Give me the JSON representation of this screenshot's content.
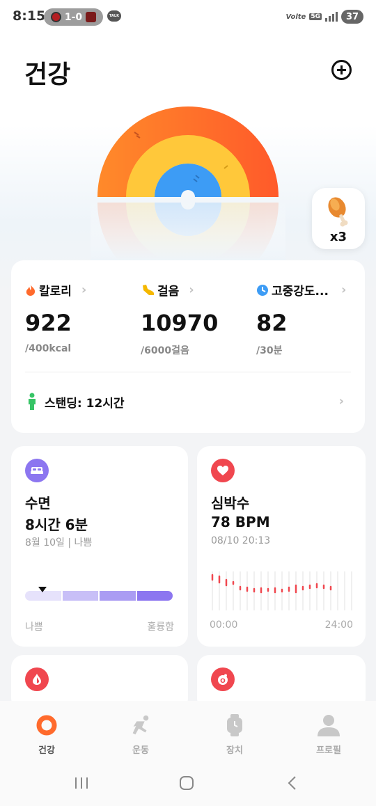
{
  "status_bar": {
    "time": "8:15",
    "score": "1-0",
    "talk_label": "TALK",
    "volte": "Volte",
    "network": "5G",
    "battery": "37"
  },
  "header": {
    "title": "건강"
  },
  "reward_badge": {
    "count_label": "x3"
  },
  "summary": {
    "metrics": [
      {
        "label": "칼로리",
        "value": "922",
        "goal": "/400kcal",
        "icon": "flame-icon",
        "color": "#ff6a2c"
      },
      {
        "label": "걸음",
        "value": "10970",
        "goal": "/6000걸음",
        "icon": "shoe-icon",
        "color": "#f5b800"
      },
      {
        "label": "고중강도...",
        "value": "82",
        "goal": "/30분",
        "icon": "clock-icon",
        "color": "#3d9cf5"
      }
    ],
    "standing": "스탠딩: 12시간"
  },
  "sleep": {
    "title": "수면",
    "value": "8시간 6분",
    "sub": "8월 10일 | 나쁨",
    "axis_left": "나쁨",
    "axis_right": "훌륭함",
    "level": 0.12
  },
  "heart": {
    "title": "심박수",
    "value": "78 BPM",
    "sub": "08/10 20:13",
    "axis_left": "00:00",
    "axis_right": "24:00"
  },
  "nav": {
    "items": [
      {
        "label": "건강",
        "icon": "health-ring-icon"
      },
      {
        "label": "운동",
        "icon": "runner-icon"
      },
      {
        "label": "장치",
        "icon": "watch-icon"
      },
      {
        "label": "프로필",
        "icon": "person-icon"
      }
    ]
  },
  "colors": {
    "ring_outer": "#ff6a2c",
    "ring_middle": "#ffc83a",
    "ring_inner": "#3d9cf5",
    "sleep_purple": "#8c76f0",
    "heart_red": "#f0474f"
  }
}
